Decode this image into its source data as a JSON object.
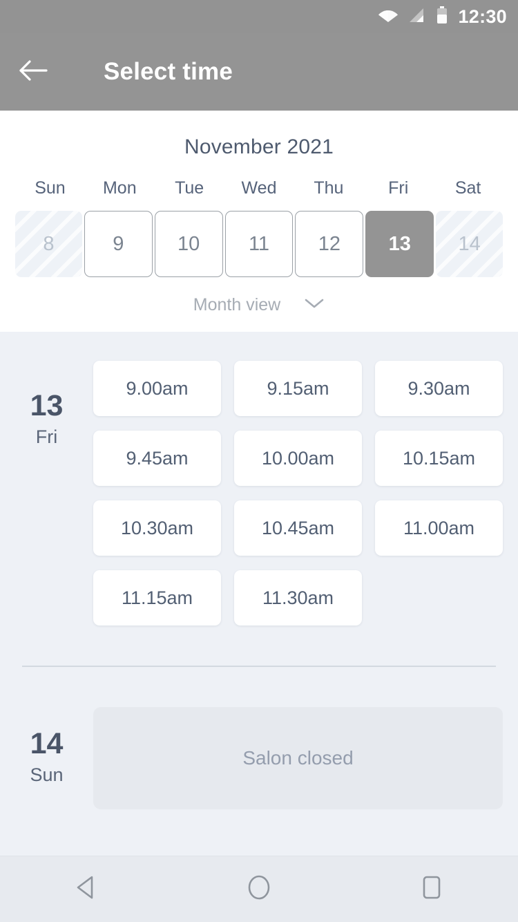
{
  "status_bar": {
    "time": "12:30",
    "icons": [
      "wifi-icon",
      "signal-icon",
      "battery-icon"
    ]
  },
  "app_bar": {
    "back_icon": "arrow-left-icon",
    "title": "Select time"
  },
  "calendar": {
    "month_title": "November 2021",
    "weekdays": [
      "Sun",
      "Mon",
      "Tue",
      "Wed",
      "Thu",
      "Fri",
      "Sat"
    ],
    "days": [
      {
        "num": "8",
        "state": "disabled"
      },
      {
        "num": "9",
        "state": "available"
      },
      {
        "num": "10",
        "state": "available"
      },
      {
        "num": "11",
        "state": "available"
      },
      {
        "num": "12",
        "state": "available"
      },
      {
        "num": "13",
        "state": "selected"
      },
      {
        "num": "14",
        "state": "disabled"
      }
    ],
    "view_toggle_label": "Month view",
    "view_toggle_icon": "chevron-down-icon"
  },
  "schedule": {
    "days": [
      {
        "day_number": "13",
        "day_of_week": "Fri",
        "closed": false,
        "slots": [
          "9.00am",
          "9.15am",
          "9.30am",
          "9.45am",
          "10.00am",
          "10.15am",
          "10.30am",
          "10.45am",
          "11.00am",
          "11.15am",
          "11.30am"
        ]
      },
      {
        "day_number": "14",
        "day_of_week": "Sun",
        "closed": true,
        "closed_label": "Salon closed",
        "slots": []
      }
    ]
  },
  "nav_bar": {
    "buttons": [
      "back-triangle-icon",
      "home-circle-icon",
      "recents-square-icon"
    ]
  },
  "colors": {
    "app_bar": "#949494",
    "selected_day": "#949494",
    "page_bg": "#eef1f6",
    "text_primary": "#4a5568",
    "text_muted": "#a6acb4",
    "closed_card": "#e6e9ee"
  }
}
